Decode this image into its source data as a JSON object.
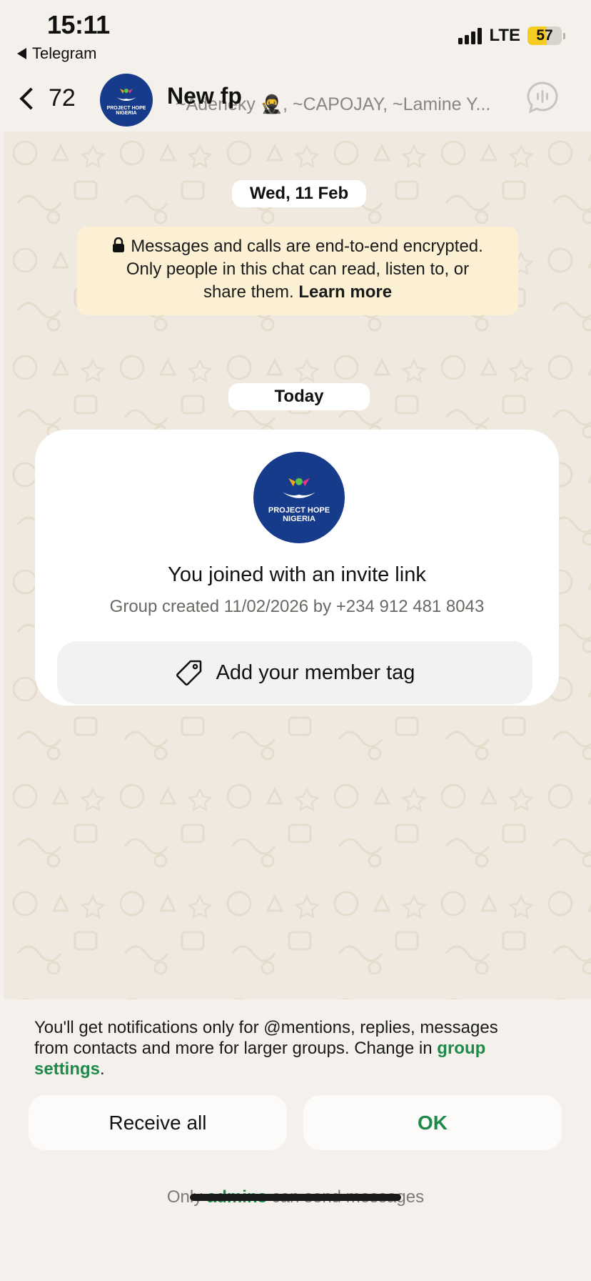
{
  "status_bar": {
    "time": "15:11",
    "back_app": "Telegram",
    "network": "LTE",
    "battery_level": "57",
    "battery_fraction": 0.57,
    "battery_color": "#f5cc22"
  },
  "header": {
    "back_count": "72",
    "title": "New fp",
    "members": "~Adeneky 🥷, ~CAPOJAY, ~Lamine Y..."
  },
  "chat": {
    "date_old": "Wed, 11 Feb",
    "encryption_notice": {
      "line1": "Messages and calls are end-to-end encrypted.",
      "line2": "Only people in this chat can read, listen to, or",
      "line3_prefix": "share them.",
      "learn_more": "Learn more"
    },
    "date_today": "Today",
    "invite_card": {
      "avatar_text_line1": "PROJECT HOPE",
      "avatar_text_line2": "NIGERIA",
      "title": "You joined with an invite link",
      "subtitle": "Group created 11/02/2026 by +234 912 481 8043",
      "tag_button_label": "Add your member tag"
    }
  },
  "bottom": {
    "notice_text": "You'll get notifications only for @mentions, replies, messages from contacts and more for larger groups. Change in ",
    "notice_link": "group settings",
    "notice_end": ".",
    "receive_all_label": "Receive all",
    "ok_label": "OK",
    "admins_prefix": "Only",
    "admins_link": "admins",
    "admins_suffix": "can send messages"
  },
  "colors": {
    "accent_green": "#1e8a4a",
    "avatar_blue": "#163b8a",
    "encryption_bg": "#fcf0d4"
  },
  "icons": [
    "telegram-back-icon",
    "signal-icon",
    "battery-icon",
    "back-chevron-icon",
    "voice-chat-icon",
    "lock-icon",
    "tag-icon"
  ]
}
